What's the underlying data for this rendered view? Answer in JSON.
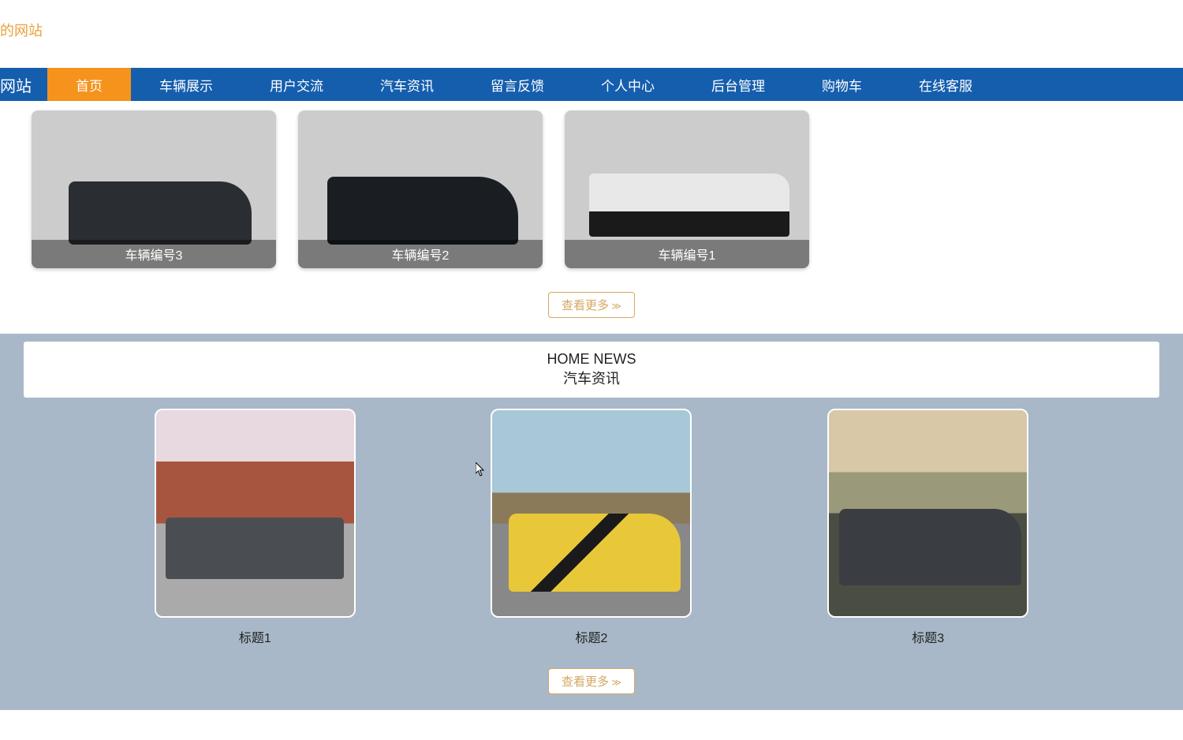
{
  "site_title": "的网站",
  "navbar": {
    "brand": "网站",
    "items": [
      {
        "label": "首页",
        "active": true
      },
      {
        "label": "车辆展示",
        "active": false
      },
      {
        "label": "用户交流",
        "active": false
      },
      {
        "label": "汽车资讯",
        "active": false
      },
      {
        "label": "留言反馈",
        "active": false
      },
      {
        "label": "个人中心",
        "active": false
      },
      {
        "label": "后台管理",
        "active": false
      },
      {
        "label": "购物车",
        "active": false
      },
      {
        "label": "在线客服",
        "active": false
      }
    ]
  },
  "vehicle_showcase": {
    "cards": [
      {
        "label": "车辆编号3"
      },
      {
        "label": "车辆编号2"
      },
      {
        "label": "车辆编号1"
      }
    ],
    "view_more": "查看更多"
  },
  "news_section": {
    "header_en": "HOME NEWS",
    "header_zh": "汽车资讯",
    "cards": [
      {
        "title": "标题1"
      },
      {
        "title": "标题2"
      },
      {
        "title": "标题3"
      }
    ],
    "view_more": "查看更多"
  }
}
